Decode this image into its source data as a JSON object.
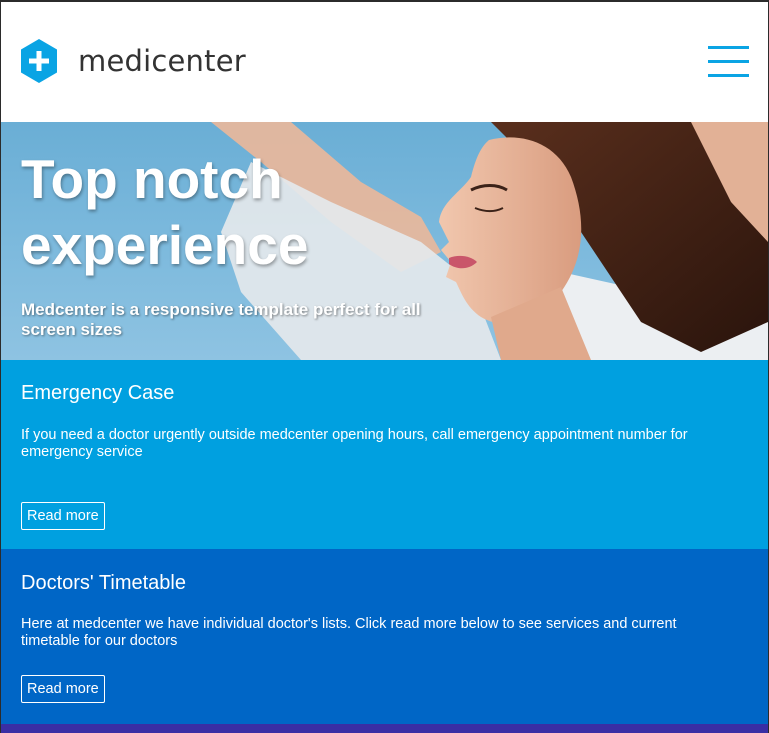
{
  "header": {
    "brand_name": "medicenter",
    "menu_icon": "hamburger-menu-icon",
    "accent_color": "#0aa4e4"
  },
  "hero": {
    "title": "Top notch experience",
    "subtitle": "Medcenter is a responsive template perfect for all screen sizes"
  },
  "panels": [
    {
      "title": "Emergency Case",
      "text": "If you need a doctor urgently outside medcenter opening hours, call emergency appointment number for emergency service",
      "button_label": "Read more",
      "color": "#00a0e0"
    },
    {
      "title": "Doctors' Timetable",
      "text": "Here at medcenter we have individual doctor's lists. Click read more below to see services and current timetable for our doctors",
      "button_label": "Read more",
      "color": "#0066c6"
    },
    {
      "color": "#3a2ea4"
    }
  ]
}
